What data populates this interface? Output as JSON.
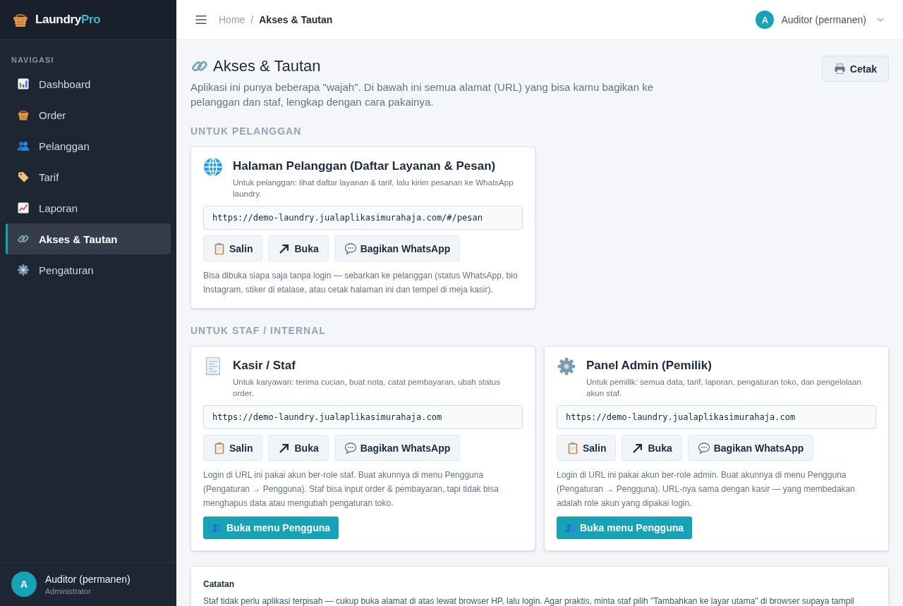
{
  "sidebar": {
    "brand": {
      "name": "Laundry",
      "accent": "Pro"
    },
    "section_label": "NAVIGASI",
    "items": [
      {
        "label": "Dashboard",
        "selected": false
      },
      {
        "label": "Order",
        "selected": false
      },
      {
        "label": "Pelanggan",
        "selected": false
      },
      {
        "label": "Tarif",
        "selected": false
      },
      {
        "label": "Laporan",
        "selected": false
      },
      {
        "label": "Akses & Tautan",
        "selected": true
      },
      {
        "label": "Pengaturan",
        "selected": false
      }
    ],
    "user": {
      "avatar": "A",
      "name": "Auditor (permanen)",
      "role": "Administrator"
    }
  },
  "topbar": {
    "breadcrumb": {
      "items": [
        "Home",
        "Akses & Tautan"
      ],
      "separator": "/"
    },
    "user": {
      "avatar": "A",
      "name": "Auditor (permanen)"
    }
  },
  "page": {
    "title": "Akses & Tautan",
    "description": "Aplikasi ini punya beberapa \"wajah\". Di bawah ini semua alamat (URL) yang bisa kamu bagikan ke pelanggan dan staf, lengkap dengan cara pakainya.",
    "print_button": "Cetak"
  },
  "sections": [
    {
      "heading": "UNTUK PELANGGAN",
      "cards": [
        {
          "title": "Halaman Pelanggan (Daftar Layanan & Pesan)",
          "subtitle": "Untuk pelanggan: lihat daftar layanan & tarif, lalu kirim pesanan ke WhatsApp laundry.",
          "url": "https://demo-laundry.jualaplikasimurahaja.com/#/pesan",
          "actions": [
            "Salin",
            "Buka",
            "Bagikan WhatsApp"
          ],
          "note": "Bisa dibuka siapa saja tanpa login — sebarkan ke pelanggan (status WhatsApp, bio Instagram, stiker di etalase, atau cetak halaman ini dan tempel di meja kasir)."
        }
      ]
    },
    {
      "heading": "UNTUK STAF / INTERNAL",
      "cards": [
        {
          "title": "Kasir / Staf",
          "subtitle": "Untuk karyawan: terima cucian, buat nota, catat pembayaran, ubah status order.",
          "url": "https://demo-laundry.jualaplikasimurahaja.com",
          "actions": [
            "Salin",
            "Buka",
            "Bagikan WhatsApp"
          ],
          "note": "Login di URL ini pakai akun ber-role staf. Buat akunnya di menu Pengguna (Pengaturan → Pengguna). Staf bisa input order & pembayaran, tapi tidak bisa menghapus data atau mengubah pengaturan toko.",
          "primary_action": "Buka menu Pengguna"
        },
        {
          "title": "Panel Admin (Pemilik)",
          "subtitle": "Untuk pemilik: semua data, tarif, laporan, pengaturan toko, dan pengelolaan akun staf.",
          "url": "https://demo-laundry.jualaplikasimurahaja.com",
          "actions": [
            "Salin",
            "Buka",
            "Bagikan WhatsApp"
          ],
          "note": "Login di URL ini pakai akun ber-role admin. Buat akunnya di menu Pengguna (Pengaturan → Pengguna). URL-nya sama dengan kasir — yang membedakan adalah role akun yang dipakai login.",
          "primary_action": "Buka menu Pengguna"
        }
      ]
    }
  ],
  "note_card": {
    "title": "Catatan",
    "text": "Staf tidak perlu aplikasi terpisah — cukup buka alamat di atas lewat browser HP, lalu login. Agar praktis, minta staf pilih \"Tambahkan ke layar utama\" di browser supaya tampil"
  }
}
